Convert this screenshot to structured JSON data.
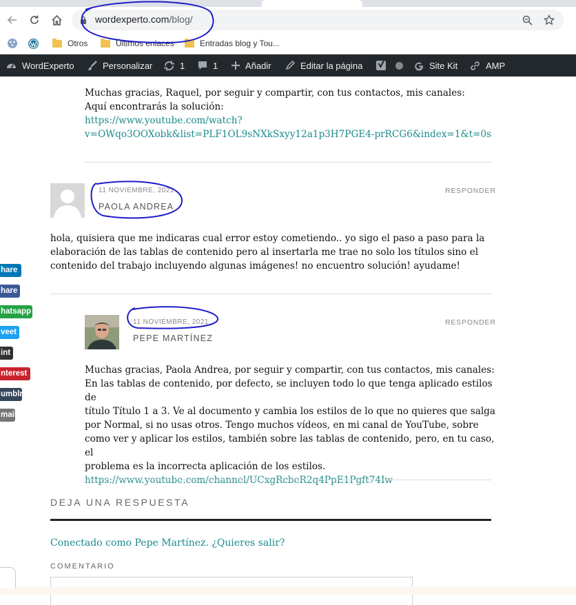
{
  "browser": {
    "url_domain": "wordexperto.com",
    "url_path": "/blog/",
    "bookmarks": [
      {
        "label": "Otros"
      },
      {
        "label": "Últimos enlaces"
      },
      {
        "label": "Entradas blog y Tou..."
      }
    ]
  },
  "adminbar": {
    "items": [
      {
        "label": "WordExperto"
      },
      {
        "label": "Personalizar"
      },
      {
        "label": "1"
      },
      {
        "label": "1"
      },
      {
        "label": "Añadir"
      },
      {
        "label": "Editar la página"
      },
      {
        "label": ""
      },
      {
        "label": "Site Kit"
      },
      {
        "label": "AMP"
      }
    ]
  },
  "comments": {
    "first_reply": {
      "text_line1": "Muchas gracias, Raquel, por seguir y compartir, con tus contactos, mis canales:",
      "text_line2": "Aquí encontrarás la solución:",
      "link_line1": "https://www.youtube.com/watch?",
      "link_line2": "v=OWqo3OOXobk&list=PLF1OL9sNXkSxyy12a1p3H7PGE4-prRCG6&index=1&t=0s"
    },
    "paola": {
      "date": "11 NOVIEMBRE, 2021",
      "author": "PAOLA ANDREA",
      "reply_label": "RESPONDER",
      "lines": [
        "hola, quisiera que me indicaras cual error estoy cometiendo.. yo sigo el paso a paso para la",
        "elaboración de las tablas de contenido pero al insertarla me trae no solo los títulos sino el",
        "contenido del trabajo incluyendo algunas imágenes! no encuentro solución! ayudame!"
      ]
    },
    "pepe": {
      "date": "11 NOVIEMBRE, 2021",
      "author": "PEPE MARTÍNEZ",
      "reply_label": "RESPONDER",
      "lines": [
        "Muchas gracias, Paola Andrea, por seguir y compartir, con tus contactos, mis canales:",
        "En las tablas de contenido, por defecto, se incluyen todo lo que tenga aplicado estilos de",
        "título Título 1 a 3. Ve al documento y cambia los estilos de lo que no quieres que salga",
        "por Normal, si no usas otros. Tengo muchos vídeos, en mi canal de YouTube, sobre",
        "como ver y aplicar los estilos, también sobre las tablas de contenido, pero, en tu caso, el",
        "problema es la incorrecta aplicación de los estilos."
      ],
      "link": "https://www.youtube.com/channel/UCxgRcbeR2q4PpE1Pgft74Iw"
    }
  },
  "share_buttons": [
    {
      "label": "hare",
      "color": "#0077b5"
    },
    {
      "label": "hare",
      "color": "#3b5998"
    },
    {
      "label": "hatsapp",
      "color": "#25a244"
    },
    {
      "label": "veet",
      "color": "#1da1f2"
    },
    {
      "label": "int",
      "color": "#333333"
    },
    {
      "label": "nterest",
      "color": "#c8232c"
    },
    {
      "label": "umblr",
      "color": "#35465c"
    },
    {
      "label": "mail",
      "color": "#777777"
    }
  ],
  "reply_form": {
    "heading": "DEJA UNA RESPUESTA",
    "logged_in_prefix": "Conectado como Pepe Martínez.",
    "logout_link": "¿Quieres salir?",
    "comment_label": "COMENTARIO"
  },
  "colors": {
    "link": "#1a8a8a",
    "adminbar": "#23282d",
    "annotation": "#1c1cc8"
  }
}
